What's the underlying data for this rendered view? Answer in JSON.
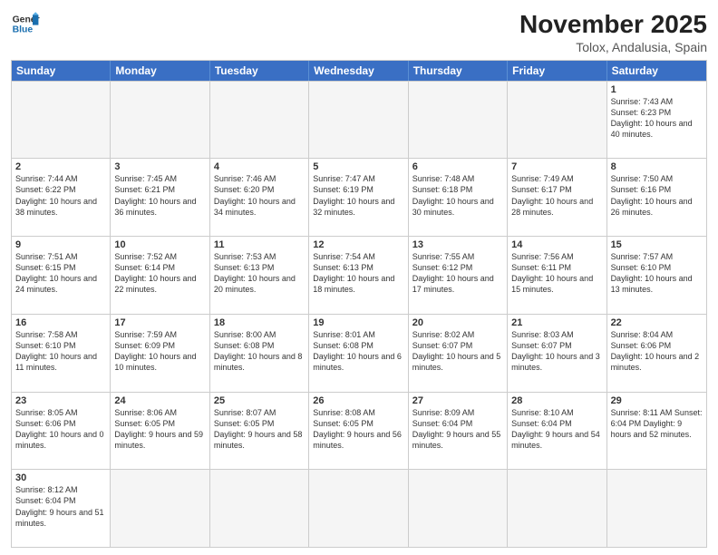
{
  "logo": {
    "line1": "General",
    "line2": "Blue"
  },
  "title": "November 2025",
  "subtitle": "Tolox, Andalusia, Spain",
  "days": [
    "Sunday",
    "Monday",
    "Tuesday",
    "Wednesday",
    "Thursday",
    "Friday",
    "Saturday"
  ],
  "rows": [
    [
      {
        "day": "",
        "info": ""
      },
      {
        "day": "",
        "info": ""
      },
      {
        "day": "",
        "info": ""
      },
      {
        "day": "",
        "info": ""
      },
      {
        "day": "",
        "info": ""
      },
      {
        "day": "",
        "info": ""
      },
      {
        "day": "1",
        "info": "Sunrise: 7:43 AM\nSunset: 6:23 PM\nDaylight: 10 hours and 40 minutes."
      }
    ],
    [
      {
        "day": "2",
        "info": "Sunrise: 7:44 AM\nSunset: 6:22 PM\nDaylight: 10 hours and 38 minutes."
      },
      {
        "day": "3",
        "info": "Sunrise: 7:45 AM\nSunset: 6:21 PM\nDaylight: 10 hours and 36 minutes."
      },
      {
        "day": "4",
        "info": "Sunrise: 7:46 AM\nSunset: 6:20 PM\nDaylight: 10 hours and 34 minutes."
      },
      {
        "day": "5",
        "info": "Sunrise: 7:47 AM\nSunset: 6:19 PM\nDaylight: 10 hours and 32 minutes."
      },
      {
        "day": "6",
        "info": "Sunrise: 7:48 AM\nSunset: 6:18 PM\nDaylight: 10 hours and 30 minutes."
      },
      {
        "day": "7",
        "info": "Sunrise: 7:49 AM\nSunset: 6:17 PM\nDaylight: 10 hours and 28 minutes."
      },
      {
        "day": "8",
        "info": "Sunrise: 7:50 AM\nSunset: 6:16 PM\nDaylight: 10 hours and 26 minutes."
      }
    ],
    [
      {
        "day": "9",
        "info": "Sunrise: 7:51 AM\nSunset: 6:15 PM\nDaylight: 10 hours and 24 minutes."
      },
      {
        "day": "10",
        "info": "Sunrise: 7:52 AM\nSunset: 6:14 PM\nDaylight: 10 hours and 22 minutes."
      },
      {
        "day": "11",
        "info": "Sunrise: 7:53 AM\nSunset: 6:13 PM\nDaylight: 10 hours and 20 minutes."
      },
      {
        "day": "12",
        "info": "Sunrise: 7:54 AM\nSunset: 6:13 PM\nDaylight: 10 hours and 18 minutes."
      },
      {
        "day": "13",
        "info": "Sunrise: 7:55 AM\nSunset: 6:12 PM\nDaylight: 10 hours and 17 minutes."
      },
      {
        "day": "14",
        "info": "Sunrise: 7:56 AM\nSunset: 6:11 PM\nDaylight: 10 hours and 15 minutes."
      },
      {
        "day": "15",
        "info": "Sunrise: 7:57 AM\nSunset: 6:10 PM\nDaylight: 10 hours and 13 minutes."
      }
    ],
    [
      {
        "day": "16",
        "info": "Sunrise: 7:58 AM\nSunset: 6:10 PM\nDaylight: 10 hours and 11 minutes."
      },
      {
        "day": "17",
        "info": "Sunrise: 7:59 AM\nSunset: 6:09 PM\nDaylight: 10 hours and 10 minutes."
      },
      {
        "day": "18",
        "info": "Sunrise: 8:00 AM\nSunset: 6:08 PM\nDaylight: 10 hours and 8 minutes."
      },
      {
        "day": "19",
        "info": "Sunrise: 8:01 AM\nSunset: 6:08 PM\nDaylight: 10 hours and 6 minutes."
      },
      {
        "day": "20",
        "info": "Sunrise: 8:02 AM\nSunset: 6:07 PM\nDaylight: 10 hours and 5 minutes."
      },
      {
        "day": "21",
        "info": "Sunrise: 8:03 AM\nSunset: 6:07 PM\nDaylight: 10 hours and 3 minutes."
      },
      {
        "day": "22",
        "info": "Sunrise: 8:04 AM\nSunset: 6:06 PM\nDaylight: 10 hours and 2 minutes."
      }
    ],
    [
      {
        "day": "23",
        "info": "Sunrise: 8:05 AM\nSunset: 6:06 PM\nDaylight: 10 hours and 0 minutes."
      },
      {
        "day": "24",
        "info": "Sunrise: 8:06 AM\nSunset: 6:05 PM\nDaylight: 9 hours and 59 minutes."
      },
      {
        "day": "25",
        "info": "Sunrise: 8:07 AM\nSunset: 6:05 PM\nDaylight: 9 hours and 58 minutes."
      },
      {
        "day": "26",
        "info": "Sunrise: 8:08 AM\nSunset: 6:05 PM\nDaylight: 9 hours and 56 minutes."
      },
      {
        "day": "27",
        "info": "Sunrise: 8:09 AM\nSunset: 6:04 PM\nDaylight: 9 hours and 55 minutes."
      },
      {
        "day": "28",
        "info": "Sunrise: 8:10 AM\nSunset: 6:04 PM\nDaylight: 9 hours and 54 minutes."
      },
      {
        "day": "29",
        "info": "Sunrise: 8:11 AM\nSunset: 6:04 PM\nDaylight: 9 hours and 52 minutes."
      }
    ],
    [
      {
        "day": "30",
        "info": "Sunrise: 8:12 AM\nSunset: 6:04 PM\nDaylight: 9 hours and 51 minutes."
      },
      {
        "day": "",
        "info": ""
      },
      {
        "day": "",
        "info": ""
      },
      {
        "day": "",
        "info": ""
      },
      {
        "day": "",
        "info": ""
      },
      {
        "day": "",
        "info": ""
      },
      {
        "day": "",
        "info": ""
      }
    ]
  ]
}
